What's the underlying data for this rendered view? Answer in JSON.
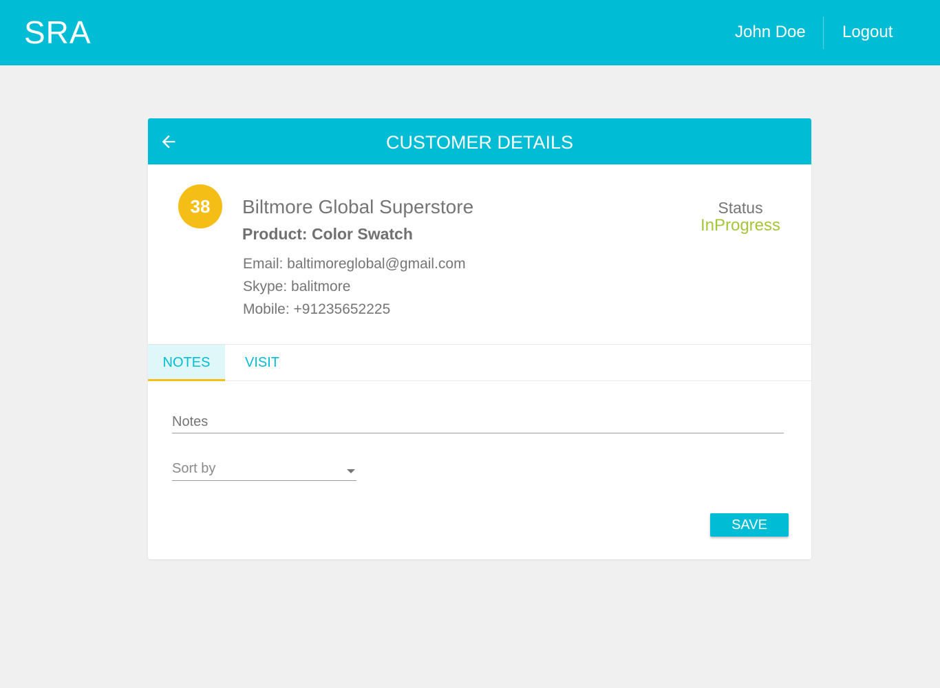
{
  "app": {
    "logo": "SRA",
    "user_name": "John Doe",
    "logout_label": "Logout"
  },
  "card": {
    "title": "CUSTOMER DETAILS",
    "back_icon": "arrow-left-icon"
  },
  "customer": {
    "rank": "38",
    "company": "Biltmore Global Superstore",
    "product": "Product: Color Swatch",
    "email": "Email: baltimoreglobal@gmail.com",
    "skype": "Skype: balitmore",
    "mobile": "Mobile: +91235652225",
    "status_label": "Status",
    "status_value": "InProgress"
  },
  "tabs": [
    {
      "label": "NOTES",
      "active": true
    },
    {
      "label": "VISIT",
      "active": false
    }
  ],
  "form": {
    "notes_placeholder": "Notes",
    "notes_value": "",
    "sort_label": "Sort by",
    "save_label": "SAVE"
  },
  "colors": {
    "primary": "#00bcd4",
    "badge": "#f5be16",
    "status": "#a4c639",
    "background": "#f0f0f0"
  }
}
